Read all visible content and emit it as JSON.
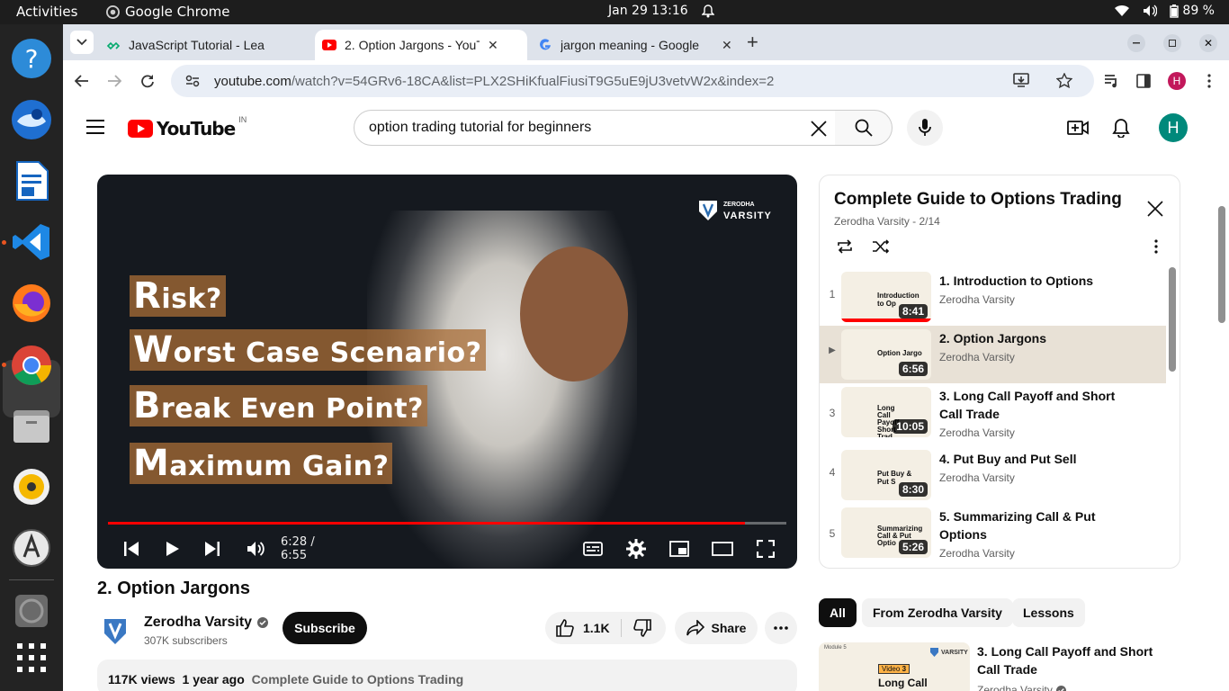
{
  "os": {
    "activities": "Activities",
    "app_name": "Google Chrome",
    "clock": "Jan 29  13:16",
    "battery": "89 %"
  },
  "browser": {
    "tabs": [
      {
        "title": "JavaScript Tutorial - Lea"
      },
      {
        "title": "2. Option Jargons - YouT"
      },
      {
        "title": "jargon meaning - Google"
      }
    ],
    "url_host": "youtube.com",
    "url_path": "/watch?v=54GRv6-18CA&list=PLX2SHiKfualFiusiT9G5uE9jU3vetvW2x&index=2",
    "profile_initial": "H"
  },
  "youtube": {
    "logo_text": "YouTube",
    "region": "IN",
    "search_value": "option trading tutorial for beginners",
    "avatar_initial": "H"
  },
  "player": {
    "brand_line1": "ZERODHA",
    "brand_line2": "VARSITY",
    "jargons": [
      {
        "cap": "R",
        "rest": "isk?"
      },
      {
        "cap": "W",
        "rest": "orst Case Scenario?"
      },
      {
        "cap": "B",
        "rest": "reak Even Point?"
      },
      {
        "cap": "M",
        "rest": "aximum Gain?"
      }
    ],
    "time": "6:28 / 6:55",
    "progress": 0.939
  },
  "video": {
    "title": "2. Option Jargons",
    "channel": "Zerodha Varsity",
    "subscribers": "307K subscribers",
    "subscribe_label": "Subscribe",
    "likes": "1.1K",
    "share_label": "Share",
    "views": "117K views",
    "age": "1 year ago",
    "playlist_link": "Complete Guide to Options Trading"
  },
  "playlist": {
    "title": "Complete Guide to Options Trading",
    "subtitle": "Zerodha Varsity - 2/14",
    "items": [
      {
        "index": "1",
        "title": "1. Introduction to Options",
        "channel": "Zerodha Varsity",
        "duration": "8:41",
        "thumb_text": "Introduction to Op"
      },
      {
        "index": "▶",
        "title": "2. Option Jargons",
        "channel": "Zerodha Varsity",
        "duration": "6:56",
        "thumb_text": "Option Jargo"
      },
      {
        "index": "3",
        "title": "3. Long Call Payoff and Short Call Trade",
        "channel": "Zerodha Varsity",
        "duration": "10:05",
        "thumb_text": "Long Call Payoff Short Trad"
      },
      {
        "index": "4",
        "title": "4. Put Buy and Put Sell",
        "channel": "Zerodha Varsity",
        "duration": "8:30",
        "thumb_text": "Put Buy & Put S"
      },
      {
        "index": "5",
        "title": "5. Summarizing Call & Put Options",
        "channel": "Zerodha Varsity",
        "duration": "5:26",
        "thumb_text": "Summarizing Call & Put Optio"
      }
    ]
  },
  "chips": [
    "All",
    "From Zerodha Varsity",
    "Lessons"
  ],
  "recommendation": {
    "title": "3. Long Call Payoff and Short Call Trade",
    "channel": "Zerodha Varsity",
    "thumb_badge": "Video",
    "thumb_num": "3",
    "thumb_module": "Module 5",
    "thumb_text": "Long Call",
    "thumb_brand": "VARSITY"
  },
  "colors": {
    "accent": "#ff0000",
    "progress_played": "#ff0000",
    "ubuntu_orange": "#e95420"
  }
}
